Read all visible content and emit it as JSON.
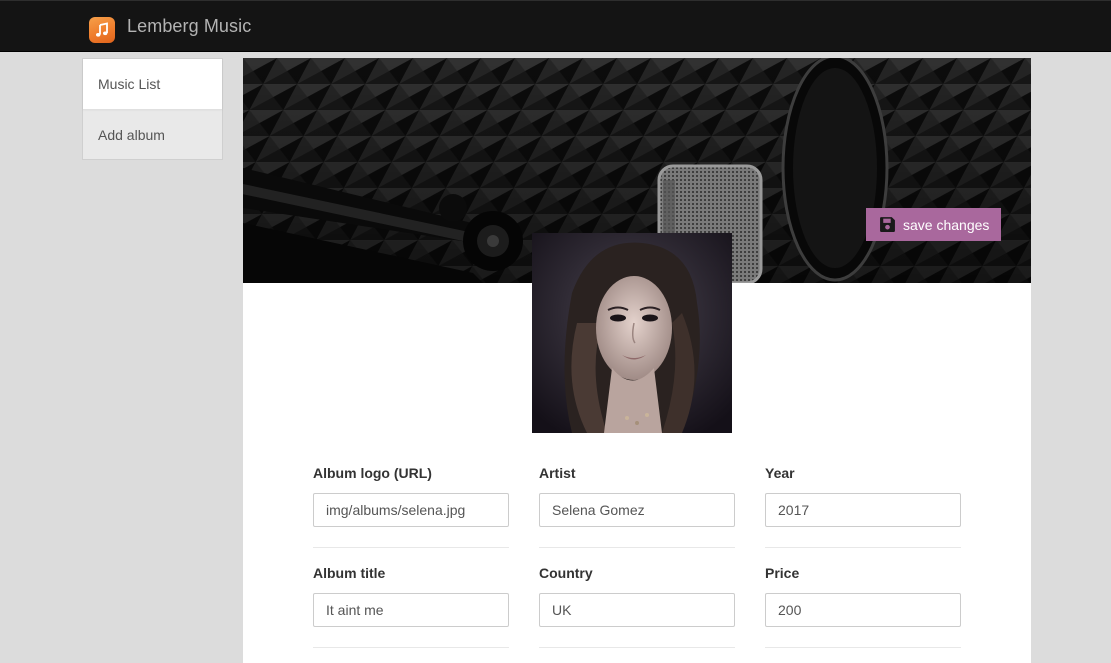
{
  "app": {
    "title": "Lemberg Music",
    "logo_icon": "music-note-icon",
    "logo_color": "#f08a35"
  },
  "sidebar": {
    "items": [
      {
        "label": "Music List",
        "active": true
      },
      {
        "label": "Add album",
        "active": false
      }
    ]
  },
  "header": {
    "save_label": "save changes",
    "save_icon": "floppy-disk-icon",
    "save_color": "#a9689d"
  },
  "form": {
    "album_logo": {
      "label": "Album logo (URL)",
      "value": "img/albums/selena.jpg"
    },
    "artist": {
      "label": "Artist",
      "value": "Selena Gomez"
    },
    "year": {
      "label": "Year",
      "value": "2017"
    },
    "album_title": {
      "label": "Album title",
      "value": "It aint me"
    },
    "country": {
      "label": "Country",
      "value": "UK"
    },
    "price": {
      "label": "Price",
      "value": "200"
    }
  }
}
